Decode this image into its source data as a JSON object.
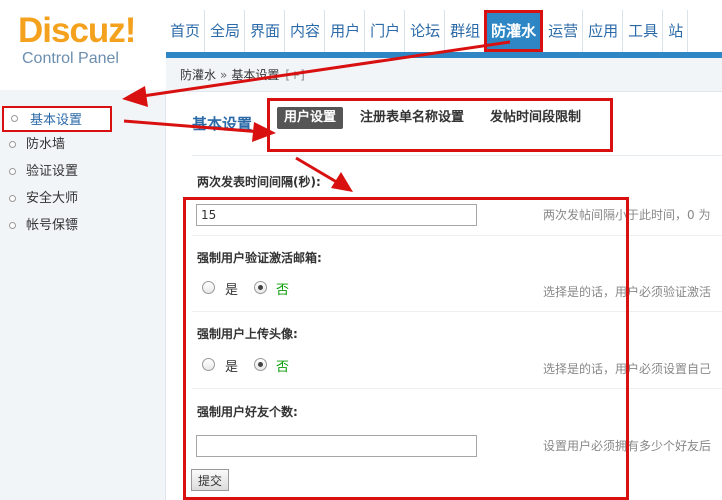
{
  "logo": {
    "word": "Discuz!",
    "sub": "Control Panel"
  },
  "nav": {
    "items": [
      {
        "label": "首页"
      },
      {
        "label": "全局"
      },
      {
        "label": "界面"
      },
      {
        "label": "内容"
      },
      {
        "label": "用户"
      },
      {
        "label": "门户"
      },
      {
        "label": "论坛"
      },
      {
        "label": "群组"
      },
      {
        "label": "防灌水",
        "active": true
      },
      {
        "label": "运营"
      },
      {
        "label": "应用"
      },
      {
        "label": "工具"
      },
      {
        "label": "站"
      }
    ]
  },
  "breadcrumb": {
    "parent": "防灌水",
    "separator": "»",
    "current": "基本设置",
    "plus": "[+]"
  },
  "sidebar": {
    "items": [
      {
        "label": "基本设置",
        "active": true
      },
      {
        "label": "防水墙"
      },
      {
        "label": "验证设置"
      },
      {
        "label": "安全大师"
      },
      {
        "label": "帐号保镖"
      }
    ]
  },
  "main": {
    "title": "基本设置",
    "tabs": [
      {
        "label": "用户设置",
        "current": true
      },
      {
        "label": "注册表单名称设置"
      },
      {
        "label": "发帖时间段限制"
      }
    ],
    "fields": {
      "post_interval": {
        "label": "两次发表时间间隔(秒):",
        "value": "15",
        "hint": "两次发帖间隔小于此时间，0 为"
      },
      "email_verify": {
        "label": "强制用户验证激活邮箱:",
        "yes": "是",
        "no": "否",
        "selected": "否",
        "hint": "选择是的话，用户必须验证激活"
      },
      "upload_avatar": {
        "label": "强制用户上传头像:",
        "yes": "是",
        "no": "否",
        "selected": "否",
        "hint": "选择是的话，用户必须设置自己"
      },
      "friend_count": {
        "label": "强制用户好友个数:",
        "value": "",
        "hint": "设置用户必须拥有多少个好友后"
      }
    },
    "submit_label": "提交"
  },
  "colors": {
    "accent": "#2e86c4",
    "annotation": "#d81010",
    "logo": "#f4a21d",
    "selected_option": "#0a9c0a"
  }
}
